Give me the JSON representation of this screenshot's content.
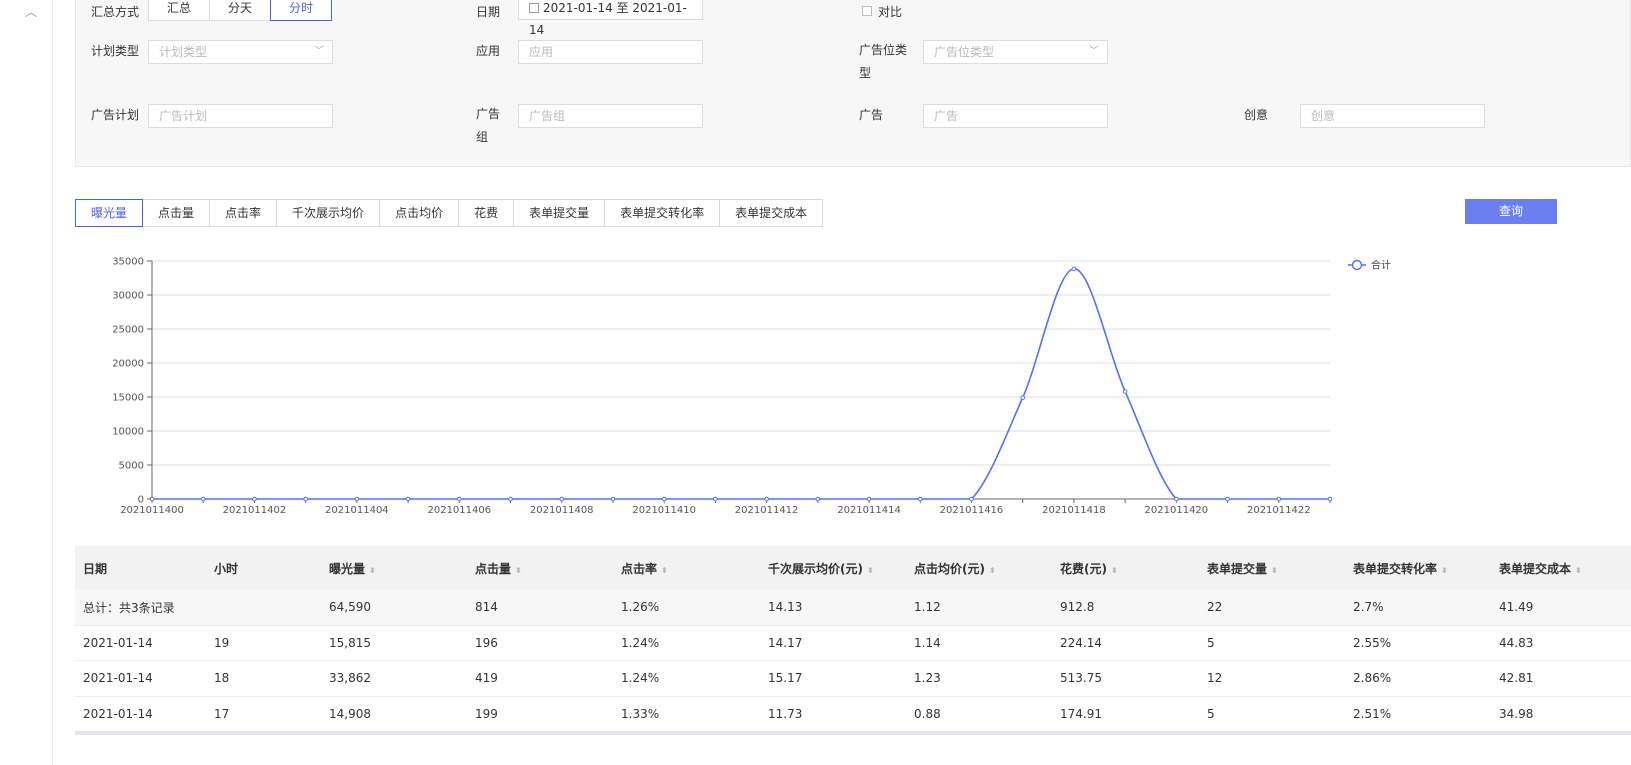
{
  "filters": {
    "summary_label": "汇总方式",
    "summary_options": [
      "汇总",
      "分天",
      "分时"
    ],
    "summary_selected": 2,
    "date_label": "日期",
    "date_value": "2021-01-14 至 2021-01-14",
    "compare_label": "对比",
    "plan_type_label": "计划类型",
    "plan_type_placeholder": "计划类型",
    "app_label": "应用",
    "app_placeholder": "应用",
    "ad_pos_label": "广告位类型",
    "ad_pos_placeholder": "广告位类型",
    "ad_plan_label": "广告计划",
    "ad_plan_placeholder": "广告计划",
    "ad_group_label": "广告组",
    "ad_group_placeholder": "广告组",
    "ad_label": "广告",
    "ad_placeholder": "广告",
    "creative_label": "创意",
    "creative_placeholder": "创意"
  },
  "metric_tabs": [
    "曝光量",
    "点击量",
    "点击率",
    "千次展示均价",
    "点击均价",
    "花费",
    "表单提交量",
    "表单提交转化率",
    "表单提交成本"
  ],
  "active_tab": 0,
  "query_label": "查询",
  "colors": {
    "accent": "#4a63e6",
    "line": "#5470f5"
  },
  "chart_data": {
    "type": "line",
    "x": [
      "2021011400",
      "2021011401",
      "2021011402",
      "2021011403",
      "2021011404",
      "2021011405",
      "2021011406",
      "2021011407",
      "2021011408",
      "2021011409",
      "2021011410",
      "2021011411",
      "2021011412",
      "2021011413",
      "2021011414",
      "2021011415",
      "2021011416",
      "2021011417",
      "2021011418",
      "2021011419",
      "2021011420",
      "2021011421",
      "2021011422",
      "2021011423"
    ],
    "x_tick_labels": [
      "2021011400",
      "2021011402",
      "2021011404",
      "2021011406",
      "2021011408",
      "2021011410",
      "2021011412",
      "2021011414",
      "2021011416",
      "2021011418",
      "2021011420",
      "2021011422"
    ],
    "series": [
      {
        "name": "合计",
        "values": [
          0,
          0,
          0,
          0,
          0,
          0,
          0,
          0,
          0,
          0,
          0,
          0,
          0,
          0,
          0,
          0,
          0,
          14908,
          33862,
          15815,
          0,
          0,
          0,
          0
        ]
      }
    ],
    "ylim": [
      0,
      35000
    ],
    "y_ticks": [
      "0",
      "5000",
      "10000",
      "15000",
      "20000",
      "25000",
      "30000",
      "35000"
    ],
    "grid": true,
    "legend": "top-right"
  },
  "table": {
    "columns": [
      "日期",
      "小时",
      "曝光量",
      "点击量",
      "点击率",
      "千次展示均价(元)",
      "点击均价(元)",
      "花费(元)",
      "表单提交量",
      "表单提交转化率",
      "表单提交成本"
    ],
    "sortable": [
      false,
      false,
      true,
      true,
      true,
      true,
      true,
      true,
      true,
      true,
      true
    ],
    "total_row": [
      "总计：共3条记录",
      "",
      "64,590",
      "814",
      "1.26%",
      "14.13",
      "1.12",
      "912.8",
      "22",
      "2.7%",
      "41.49"
    ],
    "rows": [
      [
        "2021-01-14",
        "19",
        "15,815",
        "196",
        "1.24%",
        "14.17",
        "1.14",
        "224.14",
        "5",
        "2.55%",
        "44.83"
      ],
      [
        "2021-01-14",
        "18",
        "33,862",
        "419",
        "1.24%",
        "15.17",
        "1.23",
        "513.75",
        "12",
        "2.86%",
        "42.81"
      ],
      [
        "2021-01-14",
        "17",
        "14,908",
        "199",
        "1.33%",
        "11.73",
        "0.88",
        "174.91",
        "5",
        "2.51%",
        "34.98"
      ]
    ]
  }
}
